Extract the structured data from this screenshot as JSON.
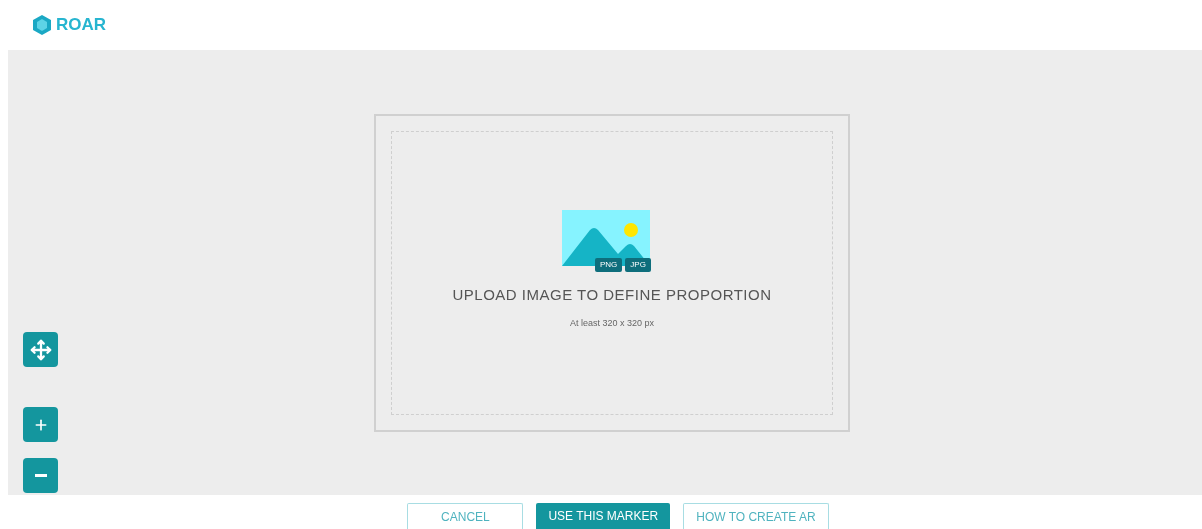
{
  "header": {
    "logo_text": "ROAR"
  },
  "upload": {
    "badges": [
      "PNG",
      "JPG"
    ],
    "title": "UPLOAD IMAGE TO DEFINE PROPORTION",
    "hint": "At least 320 x 320 px"
  },
  "controls": [
    {
      "kind": "move"
    },
    {
      "kind": "zoom-in"
    },
    {
      "kind": "zoom-out"
    }
  ],
  "buttons": [
    {
      "label": "CANCEL",
      "primary": false
    },
    {
      "label": "USE THIS MARKER",
      "primary": true
    },
    {
      "label": "HOW TO CREATE AR",
      "primary": false
    }
  ]
}
